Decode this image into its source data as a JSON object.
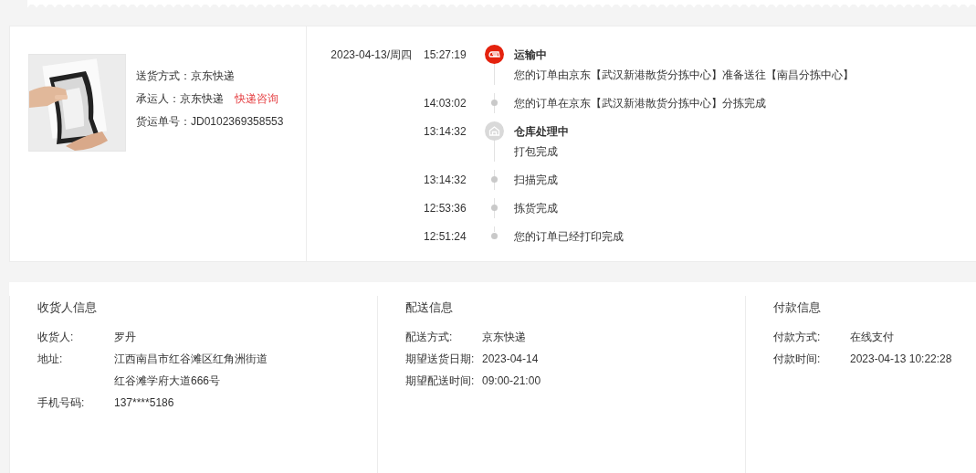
{
  "shipment": {
    "fields": [
      {
        "label": "送货方式：",
        "value": "京东快递"
      },
      {
        "label": "承运人：",
        "value": "京东快递",
        "link": "快递咨询"
      },
      {
        "label": "货运单号：",
        "value": "JD0102369358553"
      }
    ]
  },
  "tracking": [
    {
      "kind": "transit-stage",
      "date": "2023-04-13/周四",
      "time": "15:27:19",
      "title": "运输中",
      "text": "您的订单由京东【武汉新港散货分拣中心】准备送往【南昌分拣中心】",
      "active": true
    },
    {
      "kind": "step",
      "time": "14:03:02",
      "text": "您的订单在京东【武汉新港散货分拣中心】分拣完成"
    },
    {
      "kind": "warehouse-stage",
      "time": "13:14:32",
      "title": "仓库处理中",
      "text": "打包完成",
      "active": false
    },
    {
      "kind": "step",
      "time": "13:14:32",
      "text": "扫描完成"
    },
    {
      "kind": "step",
      "time": "12:53:36",
      "text": "拣货完成"
    },
    {
      "kind": "step",
      "time": "12:51:24",
      "text": "您的订单已经打印完成"
    }
  ],
  "info_sections": [
    {
      "title": "收货人信息",
      "rows": [
        {
          "label": "收货人:",
          "value": "罗丹"
        },
        {
          "label": "地址:",
          "value": "江西南昌市红谷滩区红角洲街道",
          "value_2": "红谷滩学府大道666号"
        },
        {
          "label": "手机号码:",
          "value": "137****5186"
        }
      ]
    },
    {
      "title": "配送信息",
      "rows": [
        {
          "label": "配送方式:",
          "value": "京东快递"
        },
        {
          "label": "期望送货日期:",
          "value": "2023-04-14"
        },
        {
          "label": "期望配送时间:",
          "value": "09:00-21:00"
        }
      ]
    },
    {
      "title": "付款信息",
      "rows": [
        {
          "label": "付款方式:",
          "value": "在线支付"
        },
        {
          "label": "付款时间:",
          "value": "2023-04-13 10:22:28"
        }
      ]
    }
  ]
}
